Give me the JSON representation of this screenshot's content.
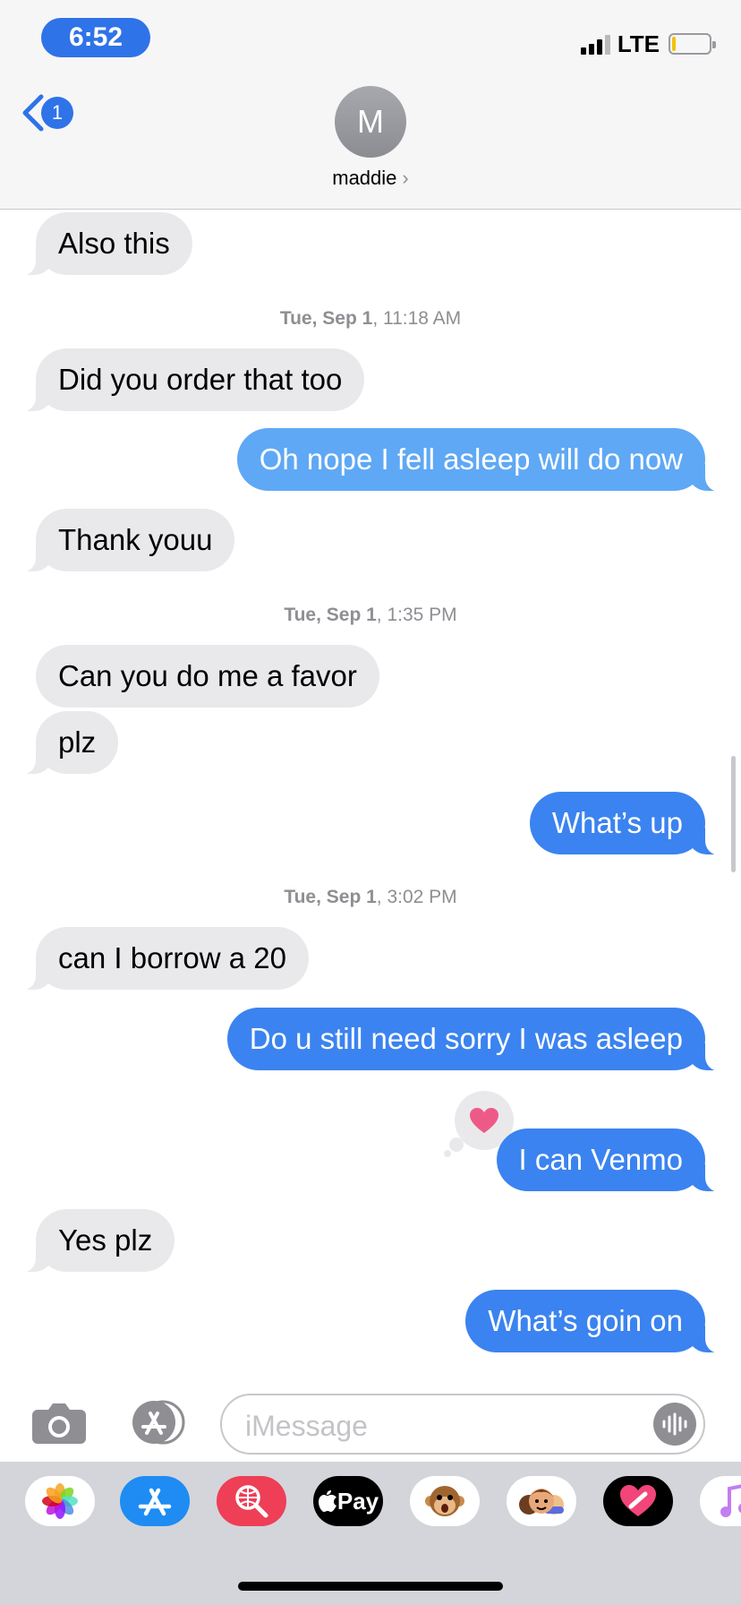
{
  "status_bar": {
    "time": "6:52",
    "network": "LTE"
  },
  "header": {
    "back_count": "1",
    "avatar_initial": "M",
    "contact_name": "maddie",
    "chevron": "›"
  },
  "thread": {
    "messages": [
      {
        "dir": "received",
        "text": "Also this"
      },
      {
        "dir": "received",
        "text": "Did you order that too"
      },
      {
        "dir": "sent",
        "text": "Oh nope I fell asleep will do now"
      },
      {
        "dir": "received",
        "text": "Thank youu"
      },
      {
        "dir": "received",
        "text": "Can you do me a favor"
      },
      {
        "dir": "received",
        "text": "plz"
      },
      {
        "dir": "sent",
        "text": "What’s up"
      },
      {
        "dir": "received",
        "text": "can I borrow a 20"
      },
      {
        "dir": "sent",
        "text": "Do u still need sorry I was asleep"
      },
      {
        "dir": "sent",
        "text": "I can Venmo",
        "tapback": "heart-icon"
      },
      {
        "dir": "received",
        "text": "Yes plz"
      },
      {
        "dir": "sent",
        "text": "What’s goin on"
      }
    ],
    "timestamps": [
      {
        "day": "Tue, Sep 1",
        "time": ", 11:18 AM"
      },
      {
        "day": "Tue, Sep 1",
        "time": ", 1:35 PM"
      },
      {
        "day": "Tue, Sep 1",
        "time": ", 3:02 PM"
      }
    ]
  },
  "input_bar": {
    "placeholder": "iMessage"
  },
  "app_drawer": {
    "items": [
      {
        "icon": "photos-icon"
      },
      {
        "icon": "app-store-icon"
      },
      {
        "icon": "web-search-icon"
      },
      {
        "icon": "apple-pay-icon",
        "label": "Pay"
      },
      {
        "icon": "animoji-monkey-icon"
      },
      {
        "icon": "memoji-icon"
      },
      {
        "icon": "digital-touch-icon"
      },
      {
        "icon": "music-icon"
      }
    ]
  },
  "colors": {
    "sent_bubble": "#3b83f0",
    "sent_bubble_light": "#5fa8f5",
    "received_bubble": "#e9e9eb",
    "accent": "#2f73e8",
    "tapback_heart": "#ee5a87"
  }
}
